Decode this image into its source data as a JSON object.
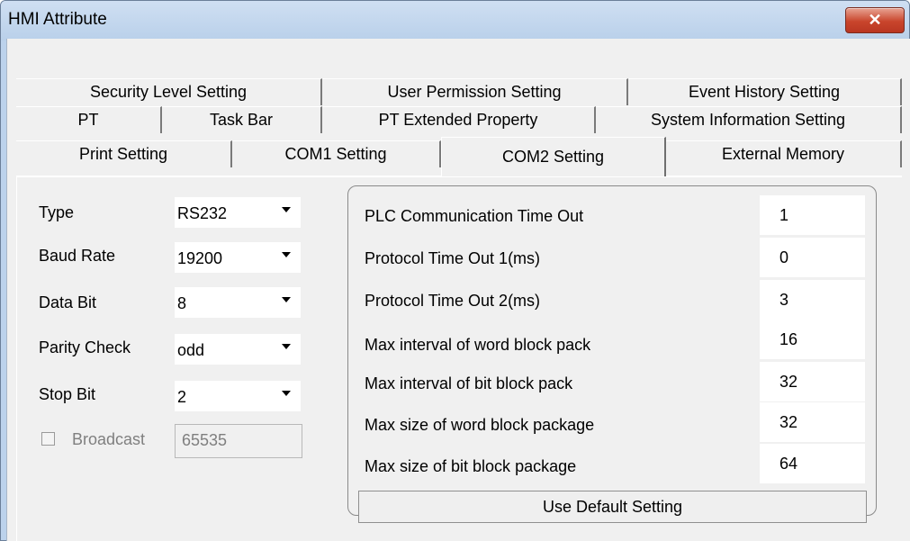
{
  "window": {
    "title": "HMI Attribute",
    "close_glyph": "✕"
  },
  "tabs": {
    "row1": [
      "Security Level Setting",
      "User Permission Setting",
      "Event History Setting"
    ],
    "row2": [
      "PT",
      "Task Bar",
      "PT Extended Property",
      "System Information Setting"
    ],
    "row3": [
      "Print Setting",
      "COM1 Setting",
      "COM2 Setting",
      "External Memory"
    ],
    "active": "COM2 Setting"
  },
  "left_settings": {
    "type": {
      "label": "Type",
      "value": "RS232"
    },
    "baud_rate": {
      "label": "Baud Rate",
      "value": "19200"
    },
    "data_bit": {
      "label": "Data Bit",
      "value": "8"
    },
    "parity_check": {
      "label": "Parity Check",
      "value": "odd"
    },
    "stop_bit": {
      "label": "Stop Bit",
      "value": "2"
    },
    "broadcast": {
      "label": "Broadcast",
      "checked": false,
      "value": "65535"
    }
  },
  "params": [
    {
      "label": "PLC Communication Time Out",
      "value": "1"
    },
    {
      "label": "Protocol Time Out 1(ms)",
      "value": "0"
    },
    {
      "label": "Protocol Time Out 2(ms)",
      "value": "3"
    },
    {
      "label": "Max interval of word block pack",
      "value": "16"
    },
    {
      "label": "Max interval of bit block pack",
      "value": "32"
    },
    {
      "label": "Max size of word block package",
      "value": "32"
    },
    {
      "label": "Max size of bit block package",
      "value": "64"
    }
  ],
  "default_button": "Use Default Setting",
  "colors": {
    "titlebar": "#bcd2ec",
    "close_button": "#c9452c",
    "dialog": "#f0f0f0"
  }
}
